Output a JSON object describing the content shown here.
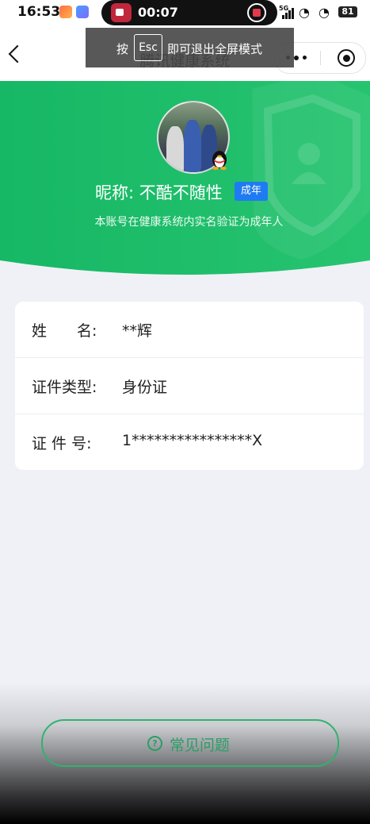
{
  "status_bar": {
    "time": "16:53",
    "recording_time": "00:07",
    "network": "5G",
    "battery": "81"
  },
  "nav": {
    "title": "腾讯健康系统"
  },
  "esc_overlay": {
    "press": "按",
    "key": "Esc",
    "text": "即可退出全屏模式"
  },
  "profile": {
    "nickname": "昵称: 不酷不随性",
    "adult_badge": "成年",
    "verify_text": "本账号在健康系统内实名验证为成年人"
  },
  "info": {
    "rows": [
      {
        "label": "姓　　名:",
        "value": "**辉"
      },
      {
        "label": "证件类型:",
        "value": "身份证"
      },
      {
        "label": "证 件 号:",
        "value": "1****************X"
      }
    ]
  },
  "faq": {
    "label": "常见问题",
    "icon_glyph": "?"
  },
  "colors": {
    "header_green": "#1fc26b",
    "accent_green": "#2a9e66",
    "badge_blue": "#1f7bf2"
  }
}
